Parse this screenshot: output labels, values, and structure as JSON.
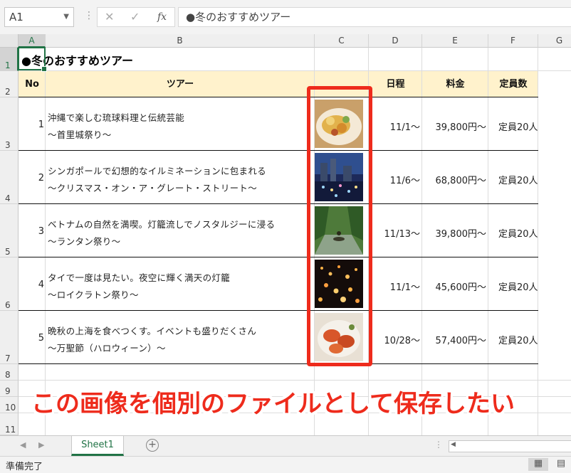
{
  "formula_bar": {
    "name_box": "A1",
    "fx_label": "fx",
    "content": "●冬のおすすめツアー"
  },
  "columns": [
    "A",
    "B",
    "C",
    "D",
    "E",
    "F",
    "G"
  ],
  "rows": [
    "1",
    "2",
    "3",
    "4",
    "5",
    "6",
    "7",
    "8",
    "9",
    "10",
    "11"
  ],
  "sheet": {
    "title": "●冬のおすすめツアー",
    "headers": {
      "no": "No",
      "tour": "ツアー",
      "schedule": "日程",
      "price": "料金",
      "capacity": "定員数"
    },
    "tours": [
      {
        "no": "1",
        "name": "沖縄で楽しむ琉球料理と伝統芸能",
        "sub": "〜首里城祭り〜",
        "date": "11/1〜",
        "price": "39,800円〜",
        "cap": "定員20人",
        "photo": "food-dish-photo"
      },
      {
        "no": "2",
        "name": "シンガポールで幻想的なイルミネーションに包まれる",
        "sub": "〜クリスマス・オン・ア・グレート・ストリート〜",
        "date": "11/6〜",
        "price": "68,800円〜",
        "cap": "定員20人",
        "photo": "night-city-photo"
      },
      {
        "no": "3",
        "name": "ベトナムの自然を満喫。灯籠流しでノスタルジーに浸る",
        "sub": "〜ランタン祭り〜",
        "date": "11/13〜",
        "price": "39,800円〜",
        "cap": "定員20人",
        "photo": "river-boat-photo"
      },
      {
        "no": "4",
        "name": "タイで一度は見たい。夜空に輝く満天の灯籠",
        "sub": "〜ロイクラトン祭り〜",
        "date": "11/1〜",
        "price": "45,600円〜",
        "cap": "定員20人",
        "photo": "sky-lanterns-photo"
      },
      {
        "no": "5",
        "name": "晩秋の上海を食べつくす。イベントも盛りだくさん",
        "sub": "〜万聖節（ハロウィーン）〜",
        "date": "10/28〜",
        "price": "57,400円〜",
        "cap": "定員20人",
        "photo": "crab-dish-photo"
      }
    ]
  },
  "annotation": {
    "callout": "この画像を個別のファイルとして保存したい",
    "color": "#ee2b1c"
  },
  "tabs": {
    "active": "Sheet1"
  },
  "status": {
    "text": "準備完了"
  }
}
